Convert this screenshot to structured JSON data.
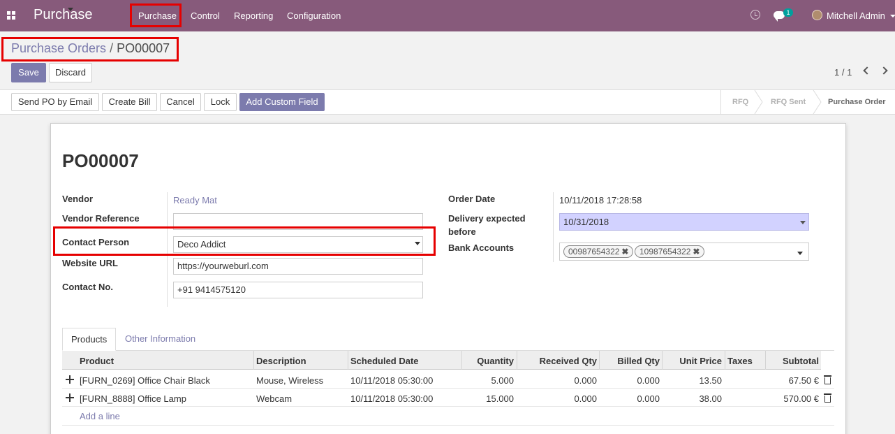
{
  "navbar": {
    "app_name": "Purchase",
    "menu": [
      "Purchase",
      "Control",
      "Reporting",
      "Configuration"
    ],
    "chat_count": "1",
    "user": "Mitchell Admin"
  },
  "breadcrumb": {
    "parent": "Purchase Orders",
    "separator": "/",
    "current": "PO00007"
  },
  "actions": {
    "save": "Save",
    "discard": "Discard"
  },
  "pager": {
    "value": "1 / 1"
  },
  "header_buttons": [
    "Send PO by Email",
    "Create Bill",
    "Cancel",
    "Lock",
    "Add Custom Field"
  ],
  "stages": [
    "RFQ",
    "RFQ Sent",
    "Purchase Order"
  ],
  "stage_active": "Purchase Order",
  "form": {
    "title": "PO00007",
    "vendor_label": "Vendor",
    "vendor_value": "Ready Mat",
    "vendor_ref_label": "Vendor Reference",
    "vendor_ref_value": "",
    "contact_label": "Contact Person",
    "contact_value": "Deco Addict",
    "website_label": "Website URL",
    "website_value": "https://yourweburl.com",
    "contact_no_label": "Contact No.",
    "contact_no_value": "+91 9414575120",
    "order_date_label": "Order Date",
    "order_date_value": "10/11/2018 17:28:58",
    "delivery_label_1": "Delivery expected",
    "delivery_label_2": "before",
    "delivery_value": "10/31/2018",
    "bank_label": "Bank Accounts",
    "bank_tags": [
      "00987654322",
      "10987654322"
    ]
  },
  "tabs": [
    "Products",
    "Other Information"
  ],
  "table": {
    "columns": [
      "Product",
      "Description",
      "Scheduled Date",
      "Quantity",
      "Received Qty",
      "Billed Qty",
      "Unit Price",
      "Taxes",
      "Subtotal"
    ],
    "rows": [
      {
        "product": "[FURN_0269] Office Chair Black",
        "description": "Mouse, Wireless",
        "date": "10/11/2018 05:30:00",
        "qty": "5.000",
        "received": "0.000",
        "billed": "0.000",
        "price": "13.50",
        "taxes": "",
        "subtotal": "67.50 €"
      },
      {
        "product": "[FURN_8888] Office Lamp",
        "description": "Webcam",
        "date": "10/11/2018 05:30:00",
        "qty": "15.000",
        "received": "0.000",
        "billed": "0.000",
        "price": "38.00",
        "taxes": "",
        "subtotal": "570.00 €"
      }
    ],
    "add_line": "Add a line"
  },
  "colors": {
    "navbar": "#875a7b",
    "primary": "#7c7bad",
    "highlight": "#e60000"
  }
}
